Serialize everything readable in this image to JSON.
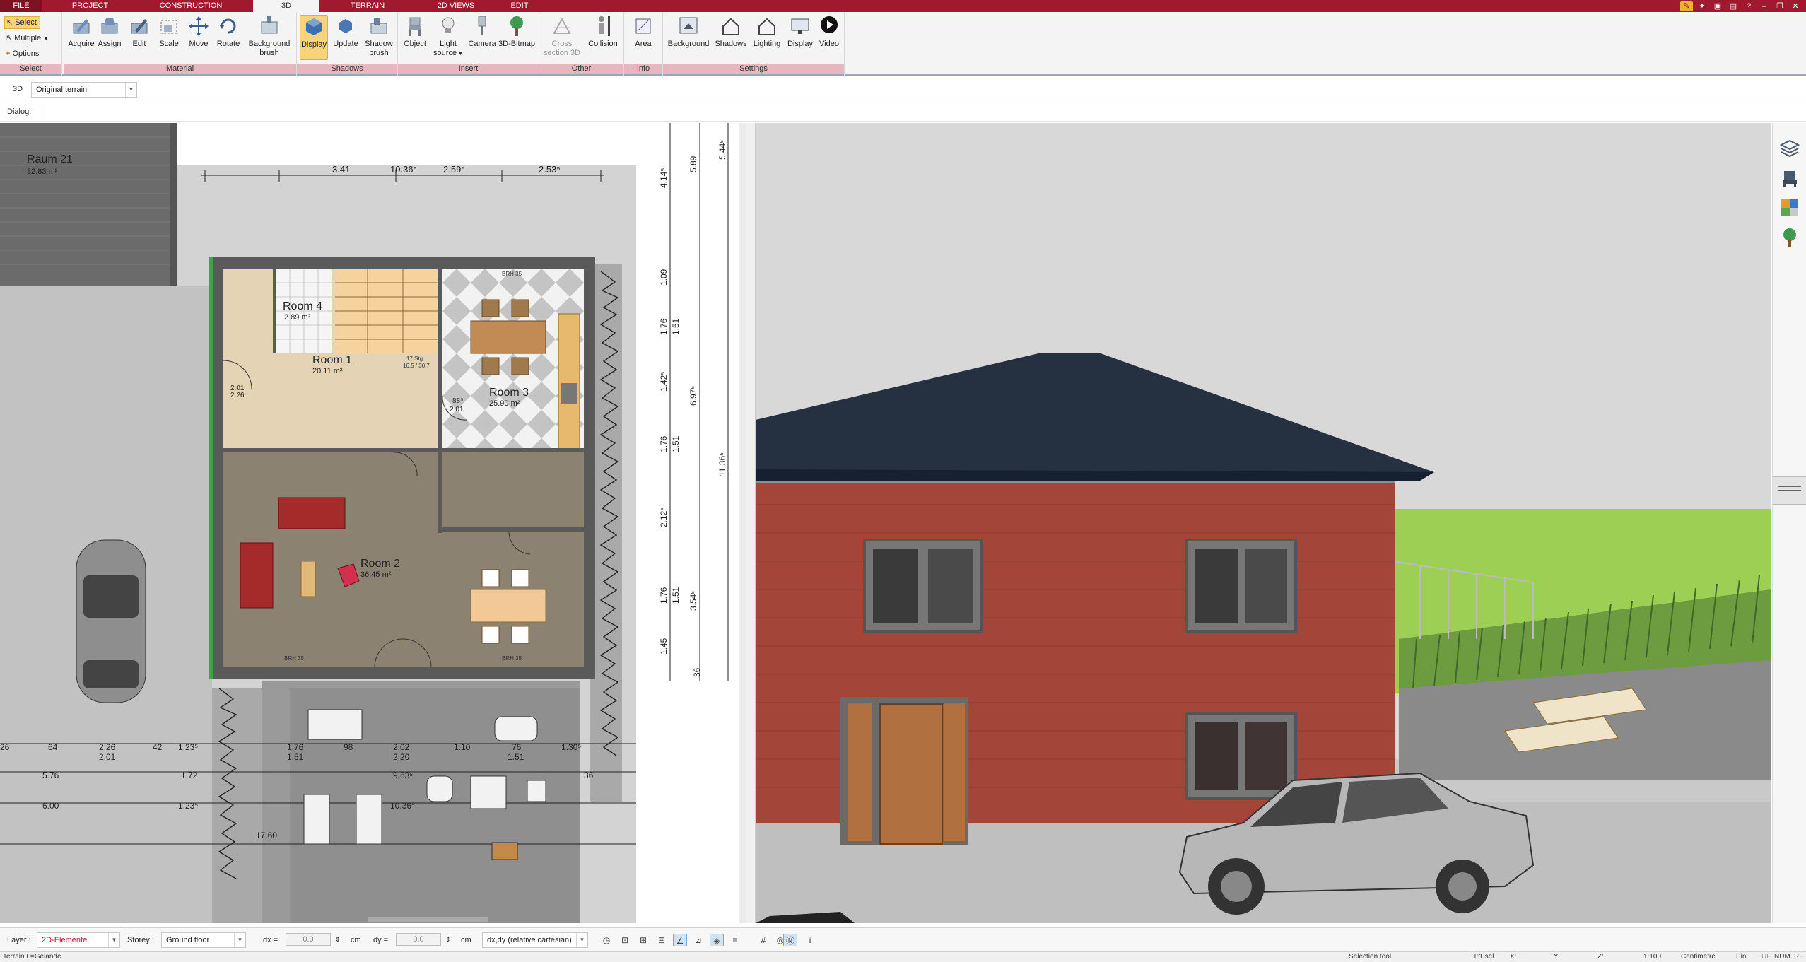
{
  "menu": {
    "tabs": [
      {
        "label": "FILE"
      },
      {
        "label": "PROJECT"
      },
      {
        "label": "CONSTRUCTION"
      },
      {
        "label": "3D",
        "active": true
      },
      {
        "label": "TERRAIN"
      },
      {
        "label": "2D VIEWS"
      },
      {
        "label": "EDIT"
      }
    ]
  },
  "ribbon": {
    "select_group": {
      "select": "Select",
      "multiple": "Multiple",
      "options": "Options",
      "label": "Select"
    },
    "material_group": {
      "acquire": "Acquire",
      "assign": "Assign",
      "edit": "Edit",
      "scale": "Scale",
      "move": "Move",
      "rotate": "Rotate",
      "background_brush": "Background brush",
      "label": "Material"
    },
    "shadows_group": {
      "display": "Display",
      "update": "Update",
      "shadow_brush": "Shadow brush",
      "label": "Shadows"
    },
    "insert_group": {
      "object": "Object",
      "light_source": "Light source",
      "camera": "Camera",
      "bitmap": "3D-Bitmap",
      "label": "Insert"
    },
    "other_group": {
      "cross_section": "Cross section 3D",
      "collision": "Collision",
      "label": "Other"
    },
    "info_group": {
      "area": "Area",
      "label": "Info"
    },
    "settings_group": {
      "background": "Background",
      "shadows": "Shadows",
      "lighting": "Lighting",
      "display": "Display",
      "video": "Video",
      "label": "Settings"
    }
  },
  "optionbar": {
    "mode": "3D",
    "terrain_select": "Original terrain",
    "dialog_label": "Dialog:"
  },
  "plan": {
    "rooms": [
      {
        "name": "Raum 21",
        "area": "32.83 m²"
      },
      {
        "name": "Room 4",
        "area": "2.89 m²"
      },
      {
        "name": "Room 1",
        "area": "20.11 m²"
      },
      {
        "name": "Room 3",
        "area": "25.90 m²"
      },
      {
        "name": "Room 2",
        "area": "36.45 m²"
      }
    ],
    "top_dims": [
      "3.41",
      "10.36⁵",
      "2.59⁵",
      "2.53⁵"
    ],
    "right_dims": [
      "5.89",
      "5.44⁵",
      "4.14⁵",
      "1.09",
      "1.76",
      "1.51",
      "1.42⁵",
      "6.97⁵",
      "1.76",
      "1.51",
      "11.36⁵",
      "2.12⁵",
      "1.76",
      "1.51",
      "3.54⁵",
      "1.45",
      "36"
    ],
    "bottom_dims": {
      "row1": [
        "26",
        "64",
        "2.26",
        "42",
        "1.23⁵",
        "1.76",
        "98",
        "2.02",
        "1.10",
        "76",
        "1.30⁵"
      ],
      "row1b": [
        "2.01",
        "1.51",
        "2.20",
        "1.51"
      ],
      "row2": [
        "5.76",
        "1.72",
        "9.63⁵",
        "36"
      ],
      "row3": [
        "6.00",
        "1.23⁵",
        "10.36⁵"
      ],
      "row4": [
        "17.60"
      ]
    },
    "door_labels": [
      "2.01",
      "2.26",
      "88⁵",
      "2.01",
      "88⁵",
      "2.01",
      "88⁵",
      "2.01",
      "1.76",
      "1.51",
      "2.02",
      "2.01"
    ],
    "stair_label": [
      "17 Stg",
      "16.5 / 30.7"
    ],
    "brh_labels": [
      "BRH 35",
      "BRH 35",
      "BRH 35",
      "BRH 35",
      "BRH 35"
    ],
    "window_dims": [
      "1.76",
      "1.51",
      "1.76",
      "1.51",
      "1.76",
      "1.51"
    ]
  },
  "layerbar": {
    "layer_label": "Layer :",
    "layer_value": "2D-Elemente",
    "storey_label": "Storey :",
    "storey_value": "Ground floor",
    "dx_label": "dx =",
    "dx_value": "0.0",
    "dx_unit": "cm",
    "dy_label": "dy =",
    "dy_value": "0.0",
    "dy_unit": "cm",
    "coord_mode": "dx,dy (relative cartesian)"
  },
  "statusbar": {
    "left": "Terrain L=Gelände",
    "tool": "Selection tool",
    "sel": "1:1 sel",
    "x": "X:",
    "y": "Y:",
    "z": "Z:",
    "scale": "1:100",
    "unit": "Centimetre",
    "mode": "Ein",
    "uf": "UF",
    "num": "NUM",
    "rf": "RF"
  },
  "colors": {
    "accent": "#a0192e",
    "ribbon_group_label": "#e6b7bf",
    "active_button": "#f8d37a"
  }
}
